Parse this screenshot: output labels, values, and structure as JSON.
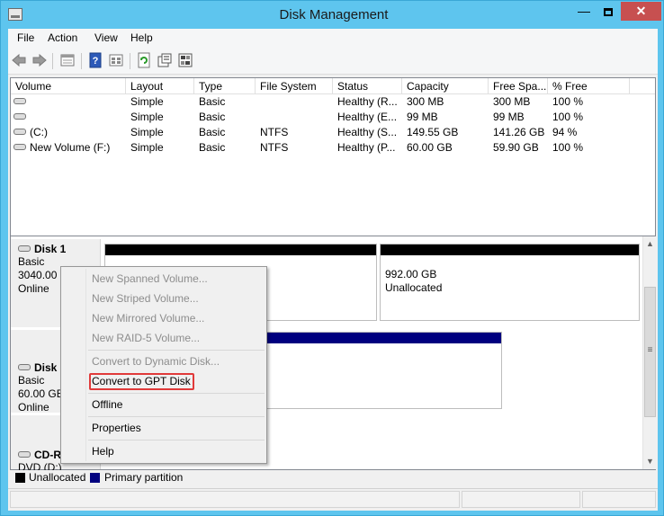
{
  "window": {
    "title": "Disk Management",
    "controls": {
      "minimize": "—",
      "close": "✕"
    },
    "title_bar_color": "#5ec5ee"
  },
  "menu": {
    "items": [
      "File",
      "Action",
      "View",
      "Help"
    ]
  },
  "toolbar": {
    "icons": [
      "back-arrow",
      "forward-arrow",
      "properties-view",
      "help-topic",
      "details-view",
      "refresh",
      "properties",
      "rescan-disks"
    ]
  },
  "volume_list": {
    "columns": [
      "Volume",
      "Layout",
      "Type",
      "File System",
      "Status",
      "Capacity",
      "Free Spa...",
      "% Free"
    ],
    "rows": [
      [
        "",
        "Simple",
        "Basic",
        "",
        "Healthy (R...",
        "300 MB",
        "300 MB",
        "100 %"
      ],
      [
        "",
        "Simple",
        "Basic",
        "",
        "Healthy (E...",
        "99 MB",
        "99 MB",
        "100 %"
      ],
      [
        "(C:)",
        "Simple",
        "Basic",
        "NTFS",
        "Healthy (S...",
        "149.55 GB",
        "141.26 GB",
        "94 %"
      ],
      [
        "New Volume (F:)",
        "Simple",
        "Basic",
        "NTFS",
        "Healthy (P...",
        "60.00 GB",
        "59.90 GB",
        "100 %"
      ]
    ]
  },
  "disks": [
    {
      "name": "Disk 1",
      "type": "Basic",
      "size": "3040.00 G",
      "status": "Online",
      "partitions": [
        {
          "size": "992.00 GB",
          "label": "Unallocated"
        }
      ]
    },
    {
      "name": "Disk 2",
      "type": "Basic",
      "size": "60.00 GB",
      "status": "Online"
    },
    {
      "name": "CD-R",
      "type": "DVD (D:)"
    }
  ],
  "legend": [
    {
      "label": "Unallocated",
      "color": "#000000"
    },
    {
      "label": "Primary partition",
      "color": "#00007f"
    }
  ],
  "context_menu": {
    "items": [
      {
        "label": "New Spanned Volume...",
        "enabled": false
      },
      {
        "label": "New Striped Volume...",
        "enabled": false
      },
      {
        "label": "New Mirrored Volume...",
        "enabled": false
      },
      {
        "label": "New RAID-5 Volume...",
        "enabled": false
      },
      {
        "label": "Convert to Dynamic Disk...",
        "enabled": false
      },
      {
        "label": "Convert to GPT Disk",
        "enabled": true,
        "highlighted": true
      },
      {
        "label": "Offline",
        "enabled": true
      },
      {
        "label": "Properties",
        "enabled": true
      },
      {
        "label": "Help",
        "enabled": true
      }
    ],
    "highlight_color": "#e03a3a"
  }
}
